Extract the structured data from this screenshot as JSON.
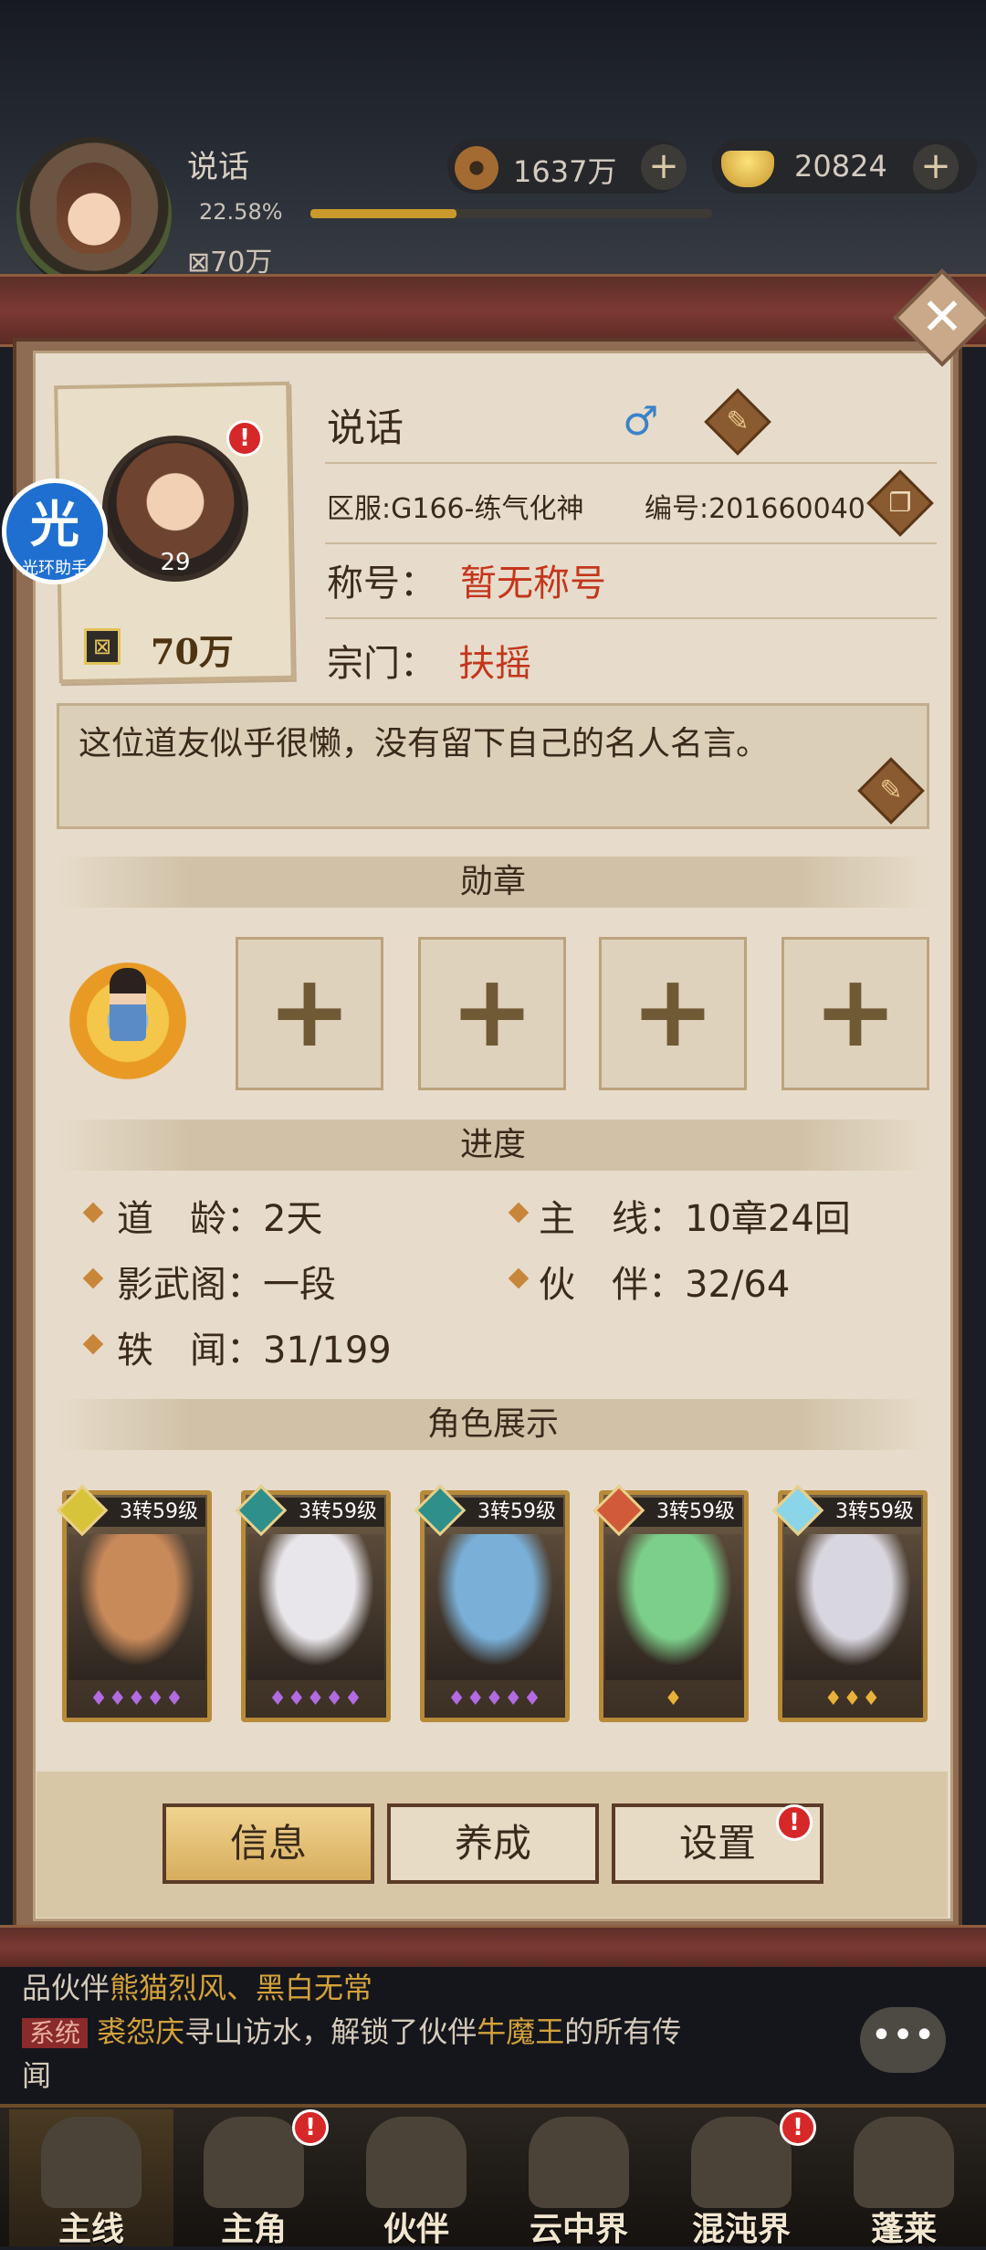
{
  "topbar": {
    "name": "说话",
    "exp_percent": "22.58%",
    "power": "70万",
    "level": "29",
    "coins": "1637万",
    "ingots": "20824"
  },
  "profile": {
    "name": "说话",
    "gender": "♂",
    "level": "29",
    "power": "70万",
    "server": "区服:G166-练气化神",
    "uid": "编号:201660040",
    "title_label": "称号：",
    "title_value": "暂无称号",
    "sect_label": "宗门：",
    "sect_value": "扶摇",
    "motto": "这位道友似乎很懒，没有留下自己的名人名言。"
  },
  "sections": {
    "medals": "勋章",
    "progress": "进度",
    "heroes": "角色展示"
  },
  "progress": {
    "age_label": "道　龄：",
    "age_value": "2天",
    "main_label": "主　线：",
    "main_value": "10章24回",
    "shadow_label": "影武阁：",
    "shadow_value": "一段",
    "partner_label": "伙　伴：",
    "partner_value": "32/64",
    "lore_label": "轶　闻：",
    "lore_value": "31/199"
  },
  "heroes": [
    {
      "level": "3转59级",
      "badge_color": "#d8c43a",
      "stars": "♦♦♦♦♦",
      "star_color": "#b26be0",
      "art": "#c98a5a"
    },
    {
      "level": "3转59级",
      "badge_color": "#2f8f8a",
      "stars": "♦♦♦♦♦",
      "star_color": "#b26be0",
      "art": "#e8e6ea"
    },
    {
      "level": "3转59级",
      "badge_color": "#2f8f8a",
      "stars": "♦♦♦♦♦",
      "star_color": "#b26be0",
      "art": "#7ab0d8"
    },
    {
      "level": "3转59级",
      "badge_color": "#d05a3a",
      "stars": "♦",
      "star_color": "#e8b23a",
      "art": "#7ccf8a"
    },
    {
      "level": "3转59级",
      "badge_color": "#8ad6e8",
      "stars": "♦♦♦",
      "star_color": "#e8b23a",
      "art": "#d8d6de"
    }
  ],
  "buttons": {
    "info": "信息",
    "develop": "养成",
    "settings": "设置"
  },
  "chat": {
    "line1_prefix": "品伙伴",
    "line1_names": "熊猫烈风、黑白无常",
    "sys_tag": "系统",
    "line2_player": "裘怨庆",
    "line2_mid": "寻山访水，解锁了伙伴",
    "line2_partner": "牛魔王",
    "line2_end": "的所有传",
    "line3": "闻"
  },
  "nav": [
    "主线",
    "主角",
    "伙伴",
    "云中界",
    "混沌界",
    "蓬莱"
  ],
  "helper": {
    "char": "光",
    "label": "光环助手"
  },
  "alert_mark": "!",
  "close_mark": "✕"
}
